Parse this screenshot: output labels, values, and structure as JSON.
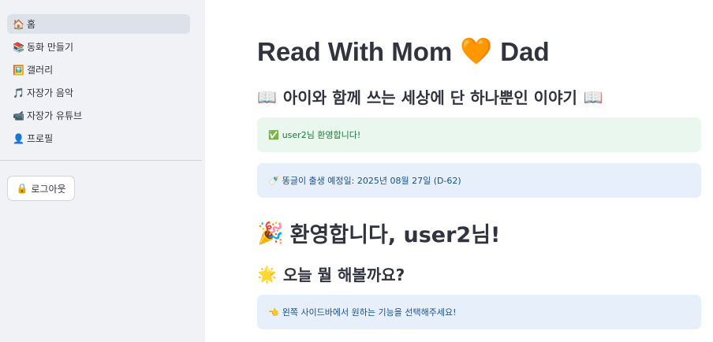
{
  "sidebar": {
    "items": [
      {
        "icon": "house-icon",
        "glyph": "🏠",
        "label": "홈"
      },
      {
        "icon": "books-icon",
        "glyph": "📚",
        "label": "동화 만들기"
      },
      {
        "icon": "picture-icon",
        "glyph": "🖼️",
        "label": "갤러리"
      },
      {
        "icon": "music-note-icon",
        "glyph": "🎵",
        "label": "자장가 음악"
      },
      {
        "icon": "video-icon",
        "glyph": "📹",
        "label": "자장가 유튜브"
      },
      {
        "icon": "profile-icon",
        "glyph": "👤",
        "label": "프로필"
      }
    ],
    "logout_icon": "🔒",
    "logout_label": "로그아웃"
  },
  "main": {
    "title_left": "Read With Mom",
    "title_heart": "🧡",
    "title_right": "Dad",
    "subtitle_book": "📖",
    "subtitle": "아이와 함께 쓰는 세상에 단 하나뿐인 이야기",
    "success_icon": "✅",
    "success_text": "user2님 환영합니다!",
    "due_icon": "🍼",
    "due_text": "똥글이 출생 예정일: 2025년 08월 27일 (D-62)",
    "welcome_icon": "🎉",
    "welcome_text": "환영합니다, user2님!",
    "question_icon": "🌟",
    "question_text": "오늘 뭘 해볼까요?",
    "hint_icon": "👈",
    "hint_text": "왼쪽 사이드바에서 원하는 기능을 선택해주세요!"
  },
  "colors": {
    "sidebar_bg": "#f0f2f6",
    "active_item_bg": "#dde1ea",
    "success_bg": "#e9f7ee",
    "success_text": "#1c7a3b",
    "info_bg": "#e7f0fa",
    "info_text": "#1a4f86"
  }
}
